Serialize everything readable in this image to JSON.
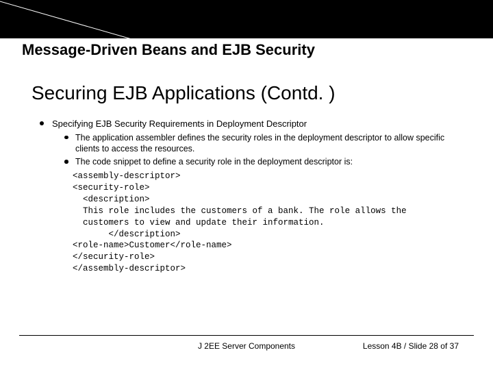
{
  "header": {
    "title": "Message-Driven Beans and EJB Security"
  },
  "main": {
    "title": "Securing EJB Applications (Contd. )",
    "bullet1": "Specifying EJB Security Requirements in Deployment Descriptor",
    "sub1": "The application assembler defines the security roles in the deployment descriptor to allow specific clients to access the resources.",
    "sub2": "The code snippet to define a security role in the deployment descriptor is:",
    "code": "<assembly-descriptor>\n<security-role>\n  <description>\n  This role includes the customers of a bank. The role allows the\n  customers to view and update their information.\n       </description>\n<role-name>Customer</role-name>\n</security-role>\n</assembly-descriptor>"
  },
  "footer": {
    "center": "J 2EE Server Components",
    "right": "Lesson 4B / Slide 28 of 37"
  }
}
